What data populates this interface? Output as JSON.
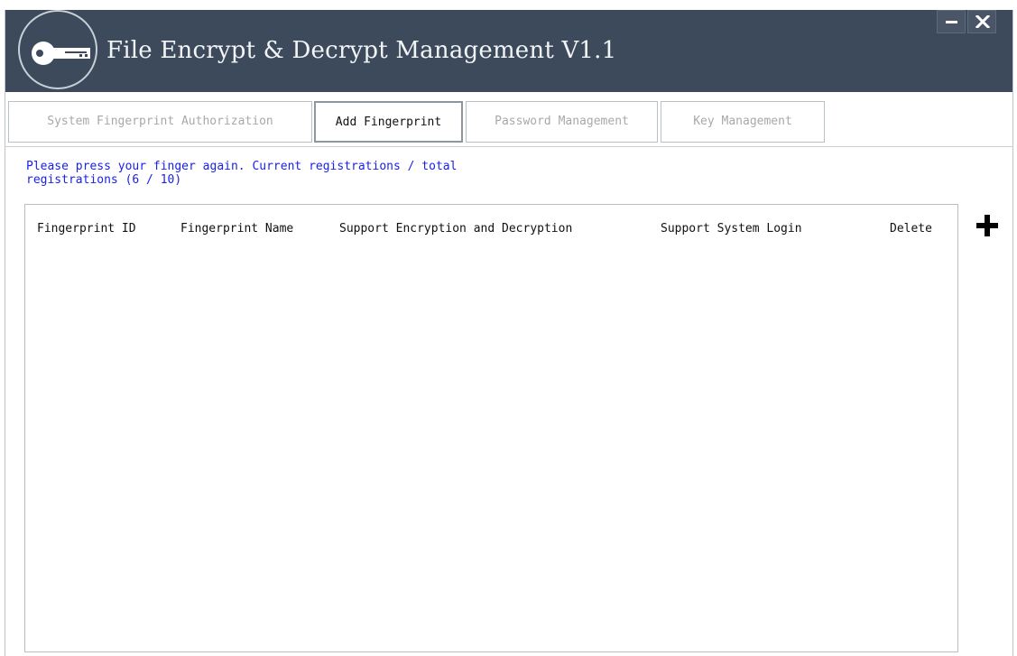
{
  "window": {
    "title": "File Encrypt & Decrypt Management V1.1",
    "logo_icon": "key-icon",
    "minimize_icon": "minimize-icon",
    "close_icon": "close-icon"
  },
  "tabs": [
    {
      "label": "System Fingerprint Authorization",
      "active": false
    },
    {
      "label": "Add Fingerprint",
      "active": true
    },
    {
      "label": "Password Management",
      "active": false
    },
    {
      "label": "Key Management",
      "active": false
    }
  ],
  "status": {
    "line1": "Please press your finger again. Current registrations / total",
    "line2": "registrations (6 / 10)"
  },
  "table": {
    "columns": [
      "Fingerprint ID",
      "Fingerprint Name",
      "Support Encryption and Decryption",
      "Support System Login",
      "Delete"
    ],
    "rows": []
  },
  "actions": {
    "add_icon": "plus-icon"
  },
  "colors": {
    "titlebar": "#3c4a5b",
    "status_text": "#1a22e6",
    "inactive_tab_text": "#a8a8a8"
  }
}
